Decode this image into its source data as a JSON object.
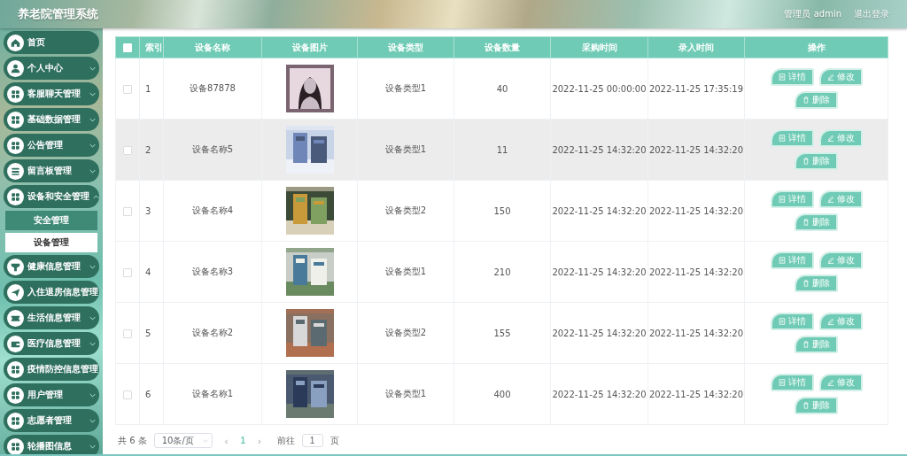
{
  "header": {
    "title": "养老院管理系统",
    "user": "管理员 admin",
    "logout": "退出登录"
  },
  "sidebar": {
    "items": [
      {
        "label": "首页"
      },
      {
        "label": "个人中心",
        "expanded": false
      },
      {
        "label": "客服聊天管理",
        "expanded": false
      },
      {
        "label": "基础数据管理",
        "expanded": false
      },
      {
        "label": "公告管理",
        "expanded": false
      },
      {
        "label": "留言板管理",
        "expanded": false
      },
      {
        "label": "设备和安全管理",
        "expanded": true,
        "children": [
          {
            "label": "安全管理",
            "selected": false
          },
          {
            "label": "设备管理",
            "selected": true
          }
        ]
      },
      {
        "label": "健康信息管理",
        "expanded": false
      },
      {
        "label": "入住退房信息管理",
        "expanded": false
      },
      {
        "label": "生活信息管理",
        "expanded": false
      },
      {
        "label": "医疗信息管理",
        "expanded": false
      },
      {
        "label": "疫情防控信息管理",
        "expanded": false
      },
      {
        "label": "用户管理",
        "expanded": false
      },
      {
        "label": "志愿者管理",
        "expanded": false
      },
      {
        "label": "轮播图信息",
        "expanded": false
      }
    ]
  },
  "table": {
    "select_all_checked": false,
    "columns": [
      "索引",
      "设备名称",
      "设备图片",
      "设备类型",
      "设备数量",
      "采购时间",
      "录入时间",
      "操作"
    ],
    "rows": [
      {
        "checked": false,
        "highlighted": false,
        "index": "1",
        "name": "设备87878",
        "type": "设备类型1",
        "count": "40",
        "purchased": "2022-11-25 00:00:00",
        "entered": "2022-11-25 17:35:19",
        "actions": [
          "详情",
          "修改",
          "删除"
        ]
      },
      {
        "checked": false,
        "highlighted": true,
        "index": "2",
        "name": "设备名称5",
        "type": "设备类型1",
        "count": "11",
        "purchased": "2022-11-25 14:32:20",
        "entered": "2022-11-25 14:32:20",
        "actions": [
          "详情",
          "修改",
          "删除"
        ]
      },
      {
        "checked": false,
        "highlighted": false,
        "index": "3",
        "name": "设备名称4",
        "type": "设备类型2",
        "count": "150",
        "purchased": "2022-11-25 14:32:20",
        "entered": "2022-11-25 14:32:20",
        "actions": [
          "详情",
          "修改",
          "删除"
        ]
      },
      {
        "checked": false,
        "highlighted": false,
        "index": "4",
        "name": "设备名称3",
        "type": "设备类型1",
        "count": "210",
        "purchased": "2022-11-25 14:32:20",
        "entered": "2022-11-25 14:32:20",
        "actions": [
          "详情",
          "修改",
          "删除"
        ]
      },
      {
        "checked": false,
        "highlighted": false,
        "index": "5",
        "name": "设备名称2",
        "type": "设备类型2",
        "count": "155",
        "purchased": "2022-11-25 14:32:20",
        "entered": "2022-11-25 14:32:20",
        "actions": [
          "详情",
          "修改",
          "删除"
        ]
      },
      {
        "checked": false,
        "highlighted": false,
        "index": "6",
        "name": "设备名称1",
        "type": "设备类型1",
        "count": "400",
        "purchased": "2022-11-25 14:32:20",
        "entered": "2022-11-25 14:32:20",
        "actions": [
          "详情",
          "修改",
          "删除"
        ]
      }
    ]
  },
  "pagination": {
    "total": "共 6 条",
    "page_size": "10条/页",
    "prev": "‹",
    "pages": [
      {
        "label": "1",
        "selected": true
      }
    ],
    "next": "›",
    "goto_label": "前往",
    "goto_value": "1",
    "goto_suffix": "页"
  }
}
